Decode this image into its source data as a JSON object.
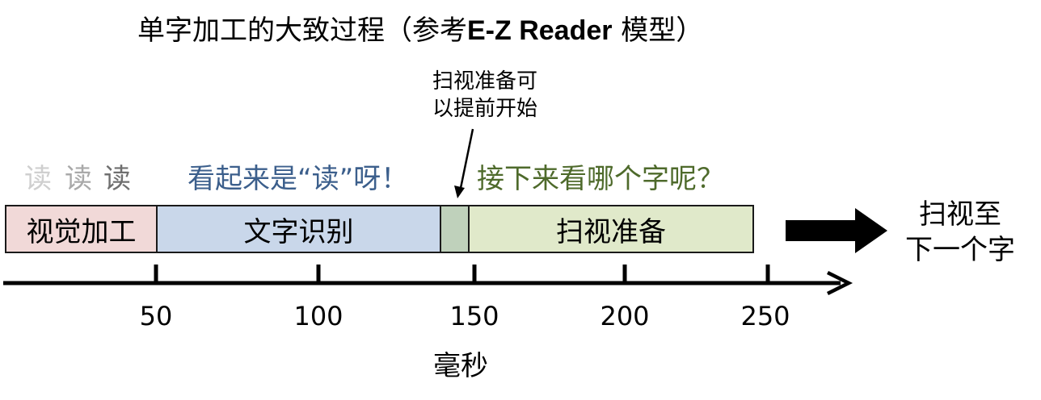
{
  "title": {
    "prefix": "单字加工的大致过程（参考",
    "model": "E-Z Reader",
    "suffix": " 模型）"
  },
  "note": {
    "line1": "扫视准备可",
    "line2": "以提前开始"
  },
  "reading_chars": [
    "读",
    "读",
    "读"
  ],
  "thoughts": {
    "blue": "看起来是“读”呀！",
    "green": "接下来看哪个字呢？"
  },
  "stages": {
    "visual": "视觉加工",
    "word_recognition": "文字识别",
    "overlap": "",
    "saccade_prep": "扫视准备"
  },
  "result": {
    "line1": "扫视至",
    "line2": "下一个字"
  },
  "axis": {
    "ticks": [
      "50",
      "100",
      "150",
      "200",
      "250"
    ],
    "label": "毫秒"
  },
  "colors": {
    "visual": "#f1d9d8",
    "word_recognition": "#c9d7ea",
    "overlap": "#bfd1bb",
    "saccade_prep": "#e0e9ca",
    "thought_blue": "#3c5f8c",
    "thought_green": "#4e6a2b"
  }
}
